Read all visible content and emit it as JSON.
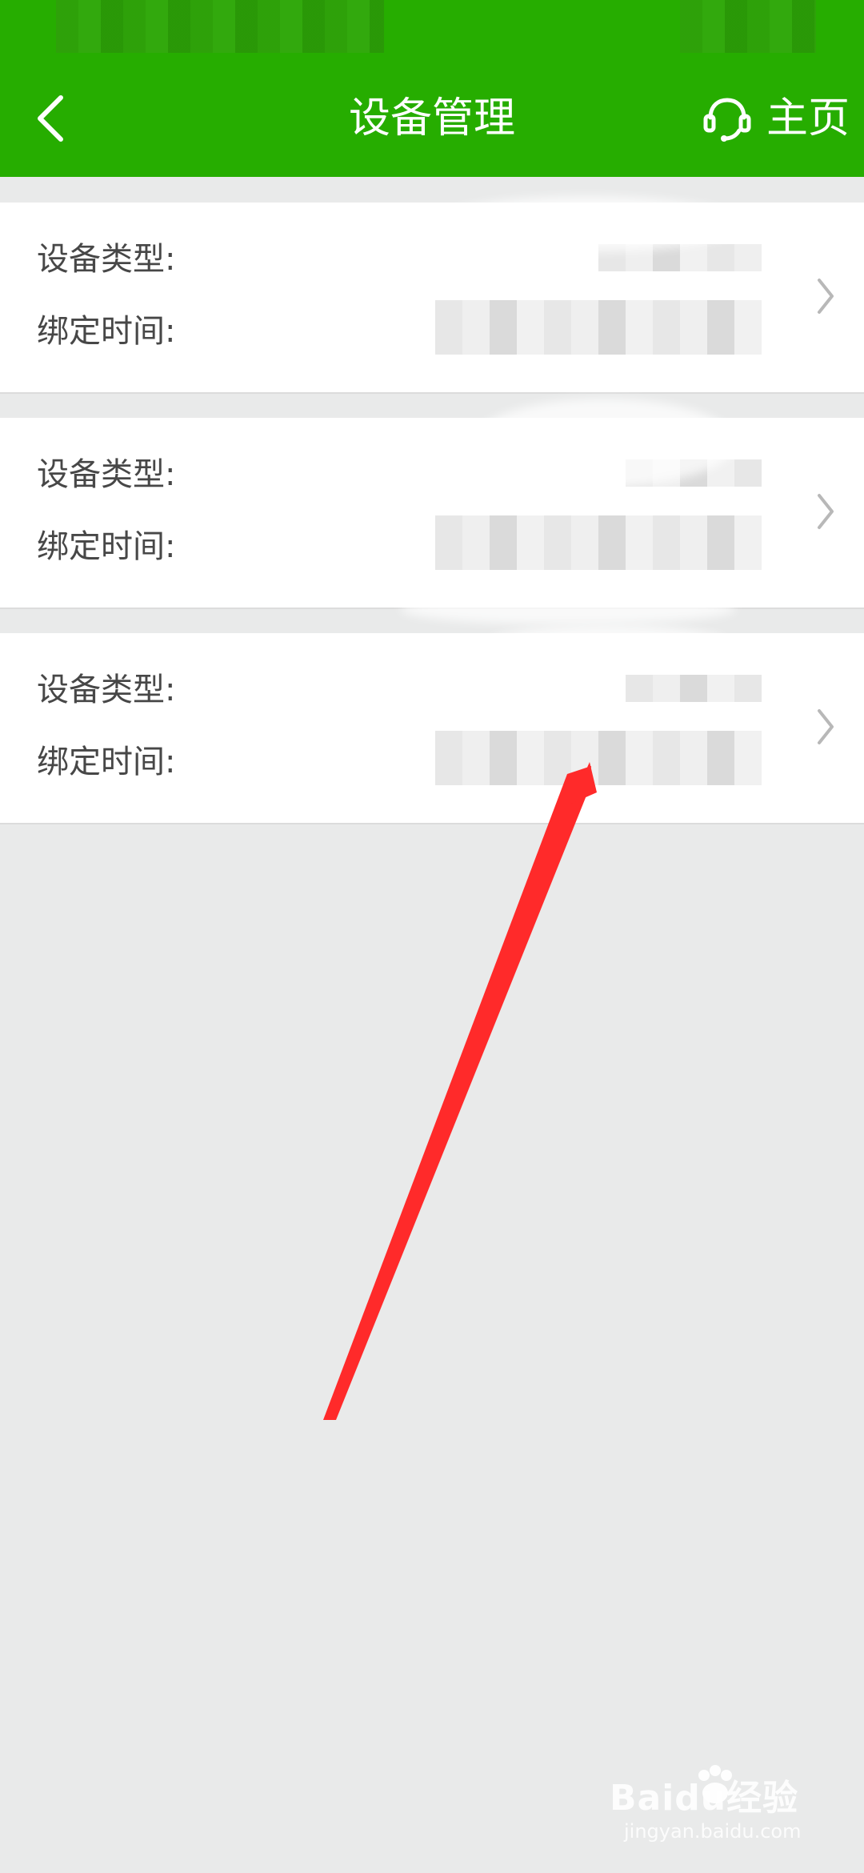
{
  "header": {
    "title": "设备管理",
    "home_label": "主页"
  },
  "cards": [
    {
      "type_label": "设备类型:",
      "bind_label": "绑定时间:"
    },
    {
      "type_label": "设备类型:",
      "bind_label": "绑定时间:"
    },
    {
      "type_label": "设备类型:",
      "bind_label": "绑定时间:"
    }
  ],
  "watermark": {
    "main": "Baidu经验",
    "sub": "jingyan.baidu.com"
  },
  "colors": {
    "header_green": "#26ad00",
    "page_background": "#e9eaea",
    "card_background": "#ffffff",
    "label_text": "#474747",
    "annotation_red": "#ff2a2a"
  },
  "icons": {
    "back": "chevron-left-icon",
    "home": "headset-icon",
    "card_action": "chevron-right-icon"
  }
}
